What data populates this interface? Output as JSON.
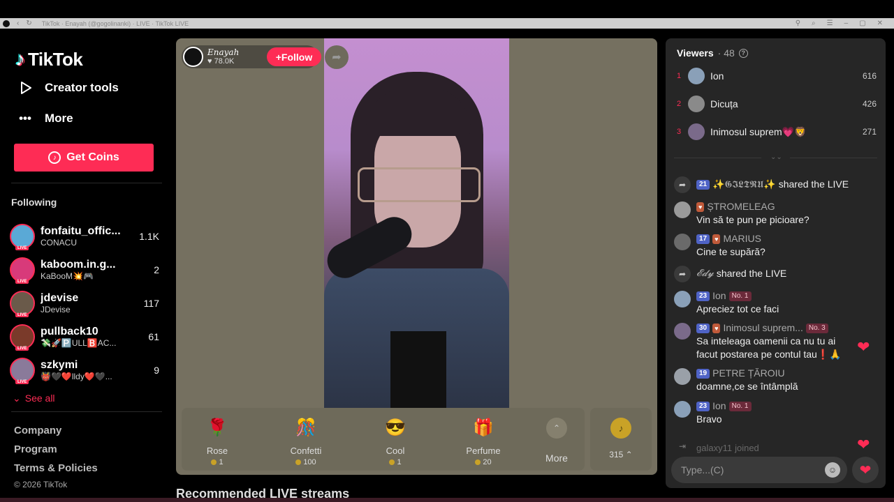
{
  "browser": {
    "tab_title": "TikTok · Enayah (@gogolinanki) · LIVE · TikTok LIVE"
  },
  "sidebar": {
    "brand": "TikTok",
    "links": [
      {
        "label": "Creator tools",
        "icon": "play-square-icon"
      },
      {
        "label": "More",
        "icon": "ellipsis-icon"
      }
    ],
    "get_coins": "Get Coins",
    "following_heading": "Following",
    "following": [
      {
        "name": "fonfaitu_offic...",
        "sub": "CONACU",
        "count": "1.1K",
        "color": "#5aa9d6"
      },
      {
        "name": "kaboom.in.g...",
        "sub": "KaBooM💥🎮",
        "count": "2",
        "color": "#d83a7a"
      },
      {
        "name": "jdevise",
        "sub": "JDevise",
        "count": "117",
        "color": "#6a5a4a"
      },
      {
        "name": "pullback10",
        "sub": "💸🚀🅿️ULL🅱️AC...",
        "count": "61",
        "color": "#7a3a2a"
      },
      {
        "name": "szkymi",
        "sub": "👹🖤❤️lldy❤️🖤...",
        "count": "9",
        "color": "#8a7a9a"
      }
    ],
    "see_all": "See all",
    "footer": [
      "Company",
      "Program",
      "Terms & Policies"
    ],
    "copyright": "© 2026 TikTok"
  },
  "live": {
    "host_name": "Enayah",
    "host_likes": "78.0K",
    "follow_label": "Follow",
    "gifts": [
      {
        "name": "Rose",
        "price": "1",
        "emoji": "🌹"
      },
      {
        "name": "Confetti",
        "price": "100",
        "emoji": "🎊"
      },
      {
        "name": "Cool",
        "price": "1",
        "emoji": "😎"
      },
      {
        "name": "Perfume",
        "price": "20",
        "emoji": "🎁"
      }
    ],
    "more_label": "More",
    "coin_balance": "315"
  },
  "recommended_heading": "Recommended LIVE streams",
  "chat": {
    "viewers_label": "Viewers",
    "viewers_count": "· 48",
    "top_viewers": [
      {
        "rank": "1",
        "name": "Ion",
        "score": "616",
        "color": "#8aa0b8"
      },
      {
        "rank": "2",
        "name": "Dicuța",
        "score": "426",
        "color": "#8a8a8a"
      },
      {
        "rank": "3",
        "name": "Inimosul suprem💗🦁",
        "score": "271",
        "color": "#7a6a8a"
      }
    ],
    "messages": [
      {
        "type": "share",
        "level": "21",
        "user": "✨𝕲𝕴𝕷𝕿𝕽𝖀✨",
        "text": "shared the LIVE"
      },
      {
        "type": "chat",
        "fan": "♥",
        "user": "ȘTROMELEAG",
        "text": "Vin să te pun pe picioare?",
        "color": "#9a9a9a"
      },
      {
        "type": "chat",
        "level": "17",
        "fan": "♥",
        "user": "MARIUS",
        "text": "Cine te supără?",
        "color": "#6a6a6a"
      },
      {
        "type": "share",
        "user": "𝓔𝓭𝔂",
        "text": "shared the LIVE"
      },
      {
        "type": "chat",
        "level": "23",
        "user": "Ion",
        "rank": "No. 1",
        "text": "Apreciez tot ce faci",
        "color": "#8aa0b8"
      },
      {
        "type": "chat",
        "level": "30",
        "fan": "♥",
        "user": "Inimosul suprem...",
        "rank": "No. 3",
        "text": "Sa inteleaga oamenii ca nu tu ai facut postarea pe contul tau❗🙏",
        "color": "#7a6a8a"
      },
      {
        "type": "chat",
        "level": "19",
        "user": "PETRE ȚĂROIU",
        "text": "doamne,ce se întâmplă",
        "color": "#9aa0a8"
      },
      {
        "type": "chat",
        "level": "23",
        "user": "Ion",
        "rank": "No. 1",
        "text": "Bravo",
        "color": "#8aa0b8"
      },
      {
        "type": "join",
        "user": "galaxy11",
        "text": "joined"
      }
    ],
    "input_placeholder": "Type...(C)"
  }
}
